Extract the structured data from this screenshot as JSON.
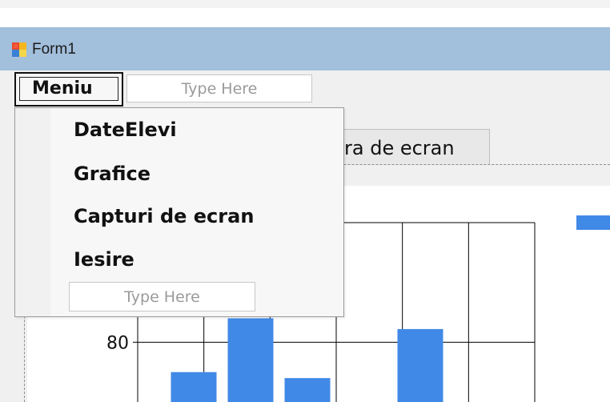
{
  "window": {
    "title": "Form1"
  },
  "menu": {
    "root_label": "Meniu",
    "top_placeholder": "Type Here",
    "items": [
      {
        "label": "DateElevi"
      },
      {
        "label": "Grafice"
      },
      {
        "label": "Capturi de ecran"
      },
      {
        "label": "Iesire"
      }
    ],
    "bottom_placeholder": "Type Here"
  },
  "tab": {
    "visible_label": "ra de ecran"
  },
  "colors": {
    "titlebar": "#a2bfdc",
    "form_background": "#f0f0f0",
    "menu_background": "#f7f7f7",
    "bar_color": "#4189e7",
    "grid_color": "#000000"
  },
  "chart_data": {
    "type": "bar",
    "categories": [
      "",
      "",
      "",
      "",
      "",
      ""
    ],
    "values": [
      77.5,
      82,
      77,
      null,
      81.1,
      null
    ],
    "title": "",
    "xlabel": "",
    "ylabel": "",
    "ylim": [
      75,
      90
    ],
    "y_tick_labels": [
      "80"
    ],
    "grid": true,
    "legend_placement": "right"
  }
}
